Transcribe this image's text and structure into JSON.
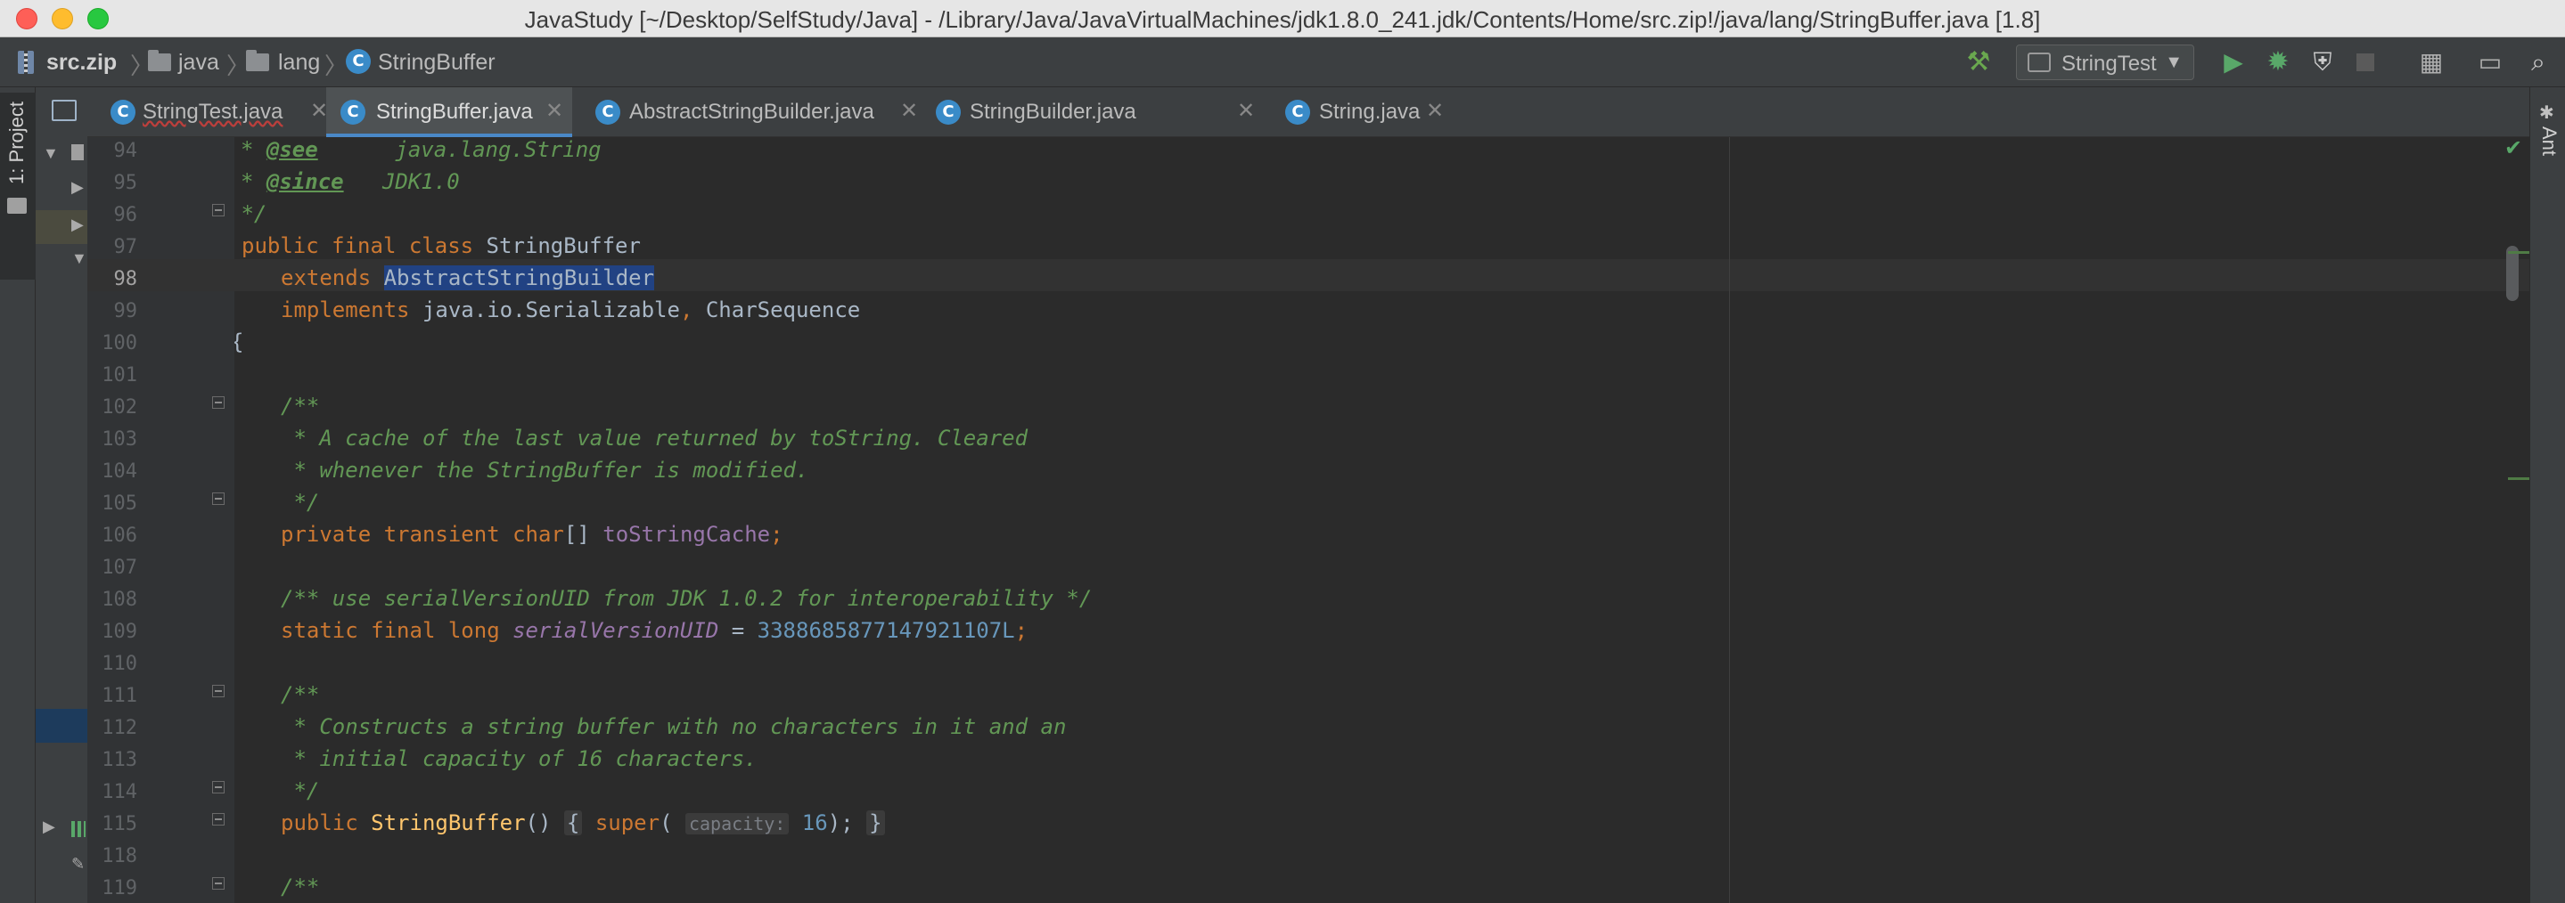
{
  "window": {
    "title": "JavaStudy [~/Desktop/SelfStudy/Java] - /Library/Java/JavaVirtualMachines/jdk1.8.0_241.jdk/Contents/Home/src.zip!/java/lang/StringBuffer.java [1.8]"
  },
  "breadcrumb": [
    "src.zip",
    "java",
    "lang",
    "StringBuffer"
  ],
  "toolbar": {
    "run_config": "StringTest",
    "icons": [
      "build-hammer-icon",
      "run-icon",
      "debug-icon",
      "coverage-icon",
      "stop-icon",
      "project-structure-icon",
      "layout-icon",
      "search-icon"
    ]
  },
  "left_strip": {
    "project_tab": "1: Project"
  },
  "right_strip": {
    "ant_tab": "Ant"
  },
  "tabs": [
    {
      "label": "StringTest.java",
      "active": false,
      "error": true
    },
    {
      "label": "StringBuffer.java",
      "active": true,
      "error": false
    },
    {
      "label": "AbstractStringBuilder.java",
      "active": false,
      "error": false
    },
    {
      "label": "StringBuilder.java",
      "active": false,
      "error": false
    },
    {
      "label": "String.java",
      "active": false,
      "error": false
    }
  ],
  "editor": {
    "current_line": 98,
    "line_numbers": [
      "94",
      "95",
      "96",
      "97",
      "98",
      "99",
      "100",
      "101",
      "102",
      "103",
      "104",
      "105",
      "106",
      "107",
      "108",
      "109",
      "110",
      "111",
      "112",
      "113",
      "114",
      "115",
      "118",
      "119"
    ],
    "code": {
      "l94_tag": "@see",
      "l94_text": "      java.lang.String",
      "l95_tag": "@since",
      "l95_text": "   JDK1.0",
      "l96": " */",
      "l97_kw": "public final class",
      "l97_name": " StringBuffer",
      "l98_kw": "extends",
      "l98_sel": "AbstractStringBuilder",
      "l99_kw": "implements",
      "l99_rest": " java.io.Serializable",
      "l99_comma": ",",
      "l99_rest2": " CharSequence",
      "l100": "{",
      "l102": "/**",
      "l103": " * A cache of the last value returned by toString. Cleared",
      "l104": " * whenever the StringBuffer is modified.",
      "l105": " */",
      "l106_kw": "private transient char",
      "l106_arr": "[] ",
      "l106_fld": "toStringCache",
      "l106_semi": ";",
      "l108": "/** use serialVersionUID from JDK 1.0.2 for interoperability */",
      "l109_kw": "static final long",
      "l109_fld": "serialVersionUID",
      "l109_eq": " = ",
      "l109_num": "3388685877147921107L",
      "l109_semi": ";",
      "l111": "/**",
      "l112": " * Constructs a string buffer with no characters in it and an",
      "l113": " * initial capacity of 16 characters.",
      "l114": " */",
      "l115_kw": "public",
      "l115_mth": "StringBuffer",
      "l115_paren": "() ",
      "l115_ob": "{",
      "l115_super": "super",
      "l115_p": "( ",
      "l115_hint": "capacity:",
      "l115_num": "16",
      "l115_end": "); ",
      "l115_cb": "}",
      "l119": "/**"
    }
  },
  "colors": {
    "keyword": "#cc7832",
    "doc_comment": "#629755",
    "field": "#9876aa",
    "number": "#6897bb",
    "method": "#ffc66d",
    "selection": "#214283",
    "text": "#a9b7c6",
    "active_tab_underline": "#4a88c7"
  }
}
